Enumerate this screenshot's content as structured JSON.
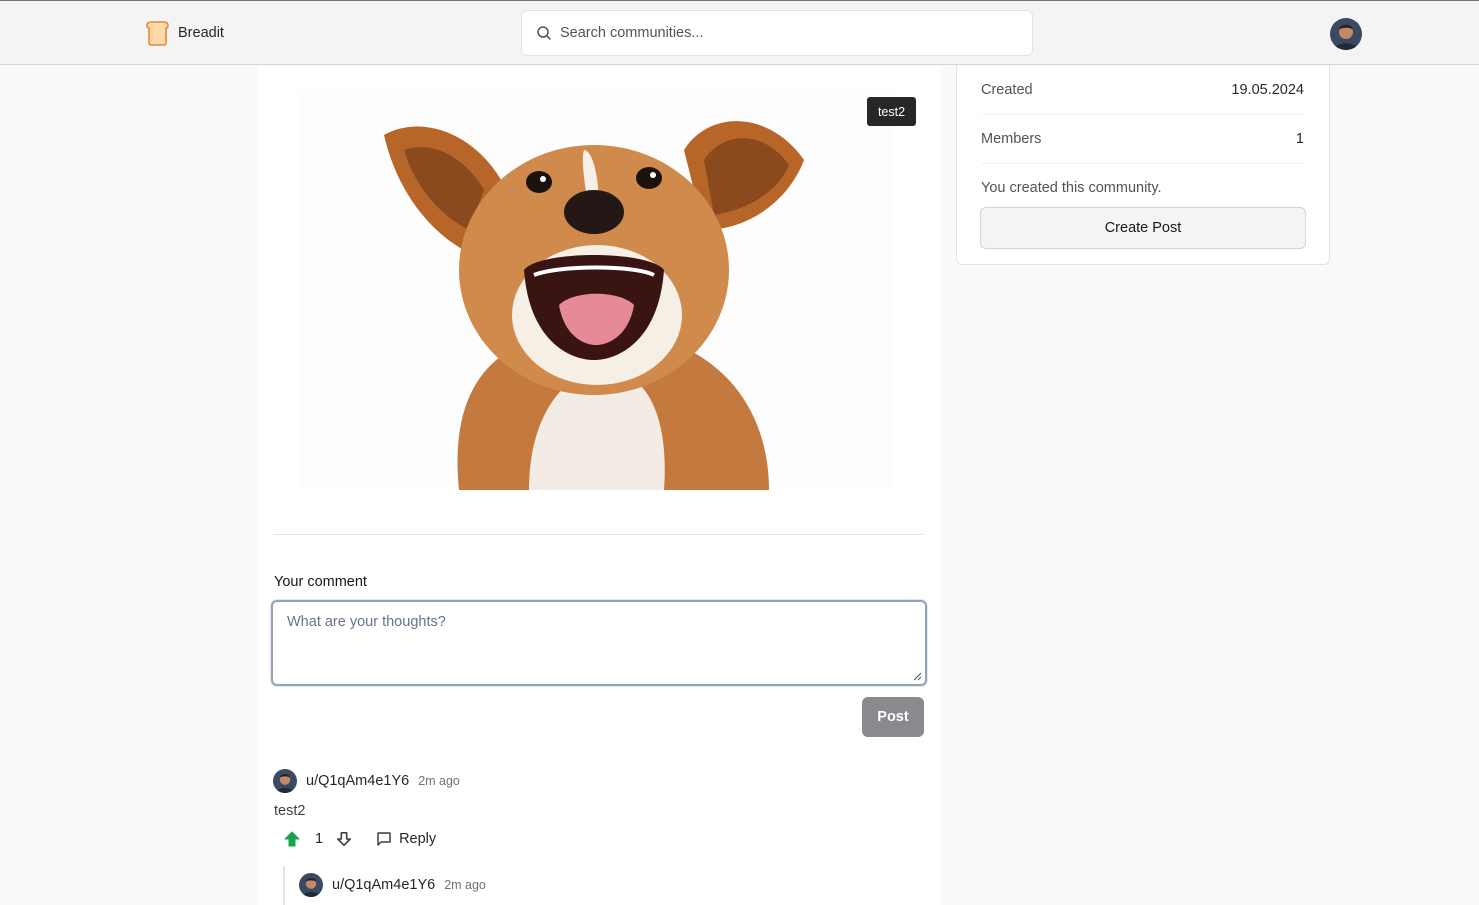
{
  "navbar": {
    "brand": "Breadit",
    "search_placeholder": "Search communities..."
  },
  "post": {
    "flair": "test2",
    "image_alt": "Smiling dog photo"
  },
  "comment_form": {
    "label": "Your comment",
    "placeholder": "What are your thoughts?",
    "submit_label": "Post"
  },
  "comments": [
    {
      "username": "u/Q1qAm4e1Y6",
      "time": "2m ago",
      "text": "test2",
      "votes": "1",
      "vote_state": "up",
      "reply_label": "Reply"
    }
  ],
  "replies": [
    {
      "username": "u/Q1qAm4e1Y6",
      "time": "2m ago"
    }
  ],
  "sidebar": {
    "rows": [
      {
        "label": "Created",
        "value": "19.05.2024"
      },
      {
        "label": "Members",
        "value": "1"
      }
    ],
    "note": "You created this community.",
    "button_label": "Create Post"
  },
  "colors": {
    "upvote_active": "#16a34a",
    "badge_bg": "#27272a",
    "post_button_bg": "#8a8a8e"
  },
  "icons": [
    "bread-icon",
    "search-icon",
    "upvote-icon",
    "downvote-icon",
    "message-square-icon"
  ]
}
